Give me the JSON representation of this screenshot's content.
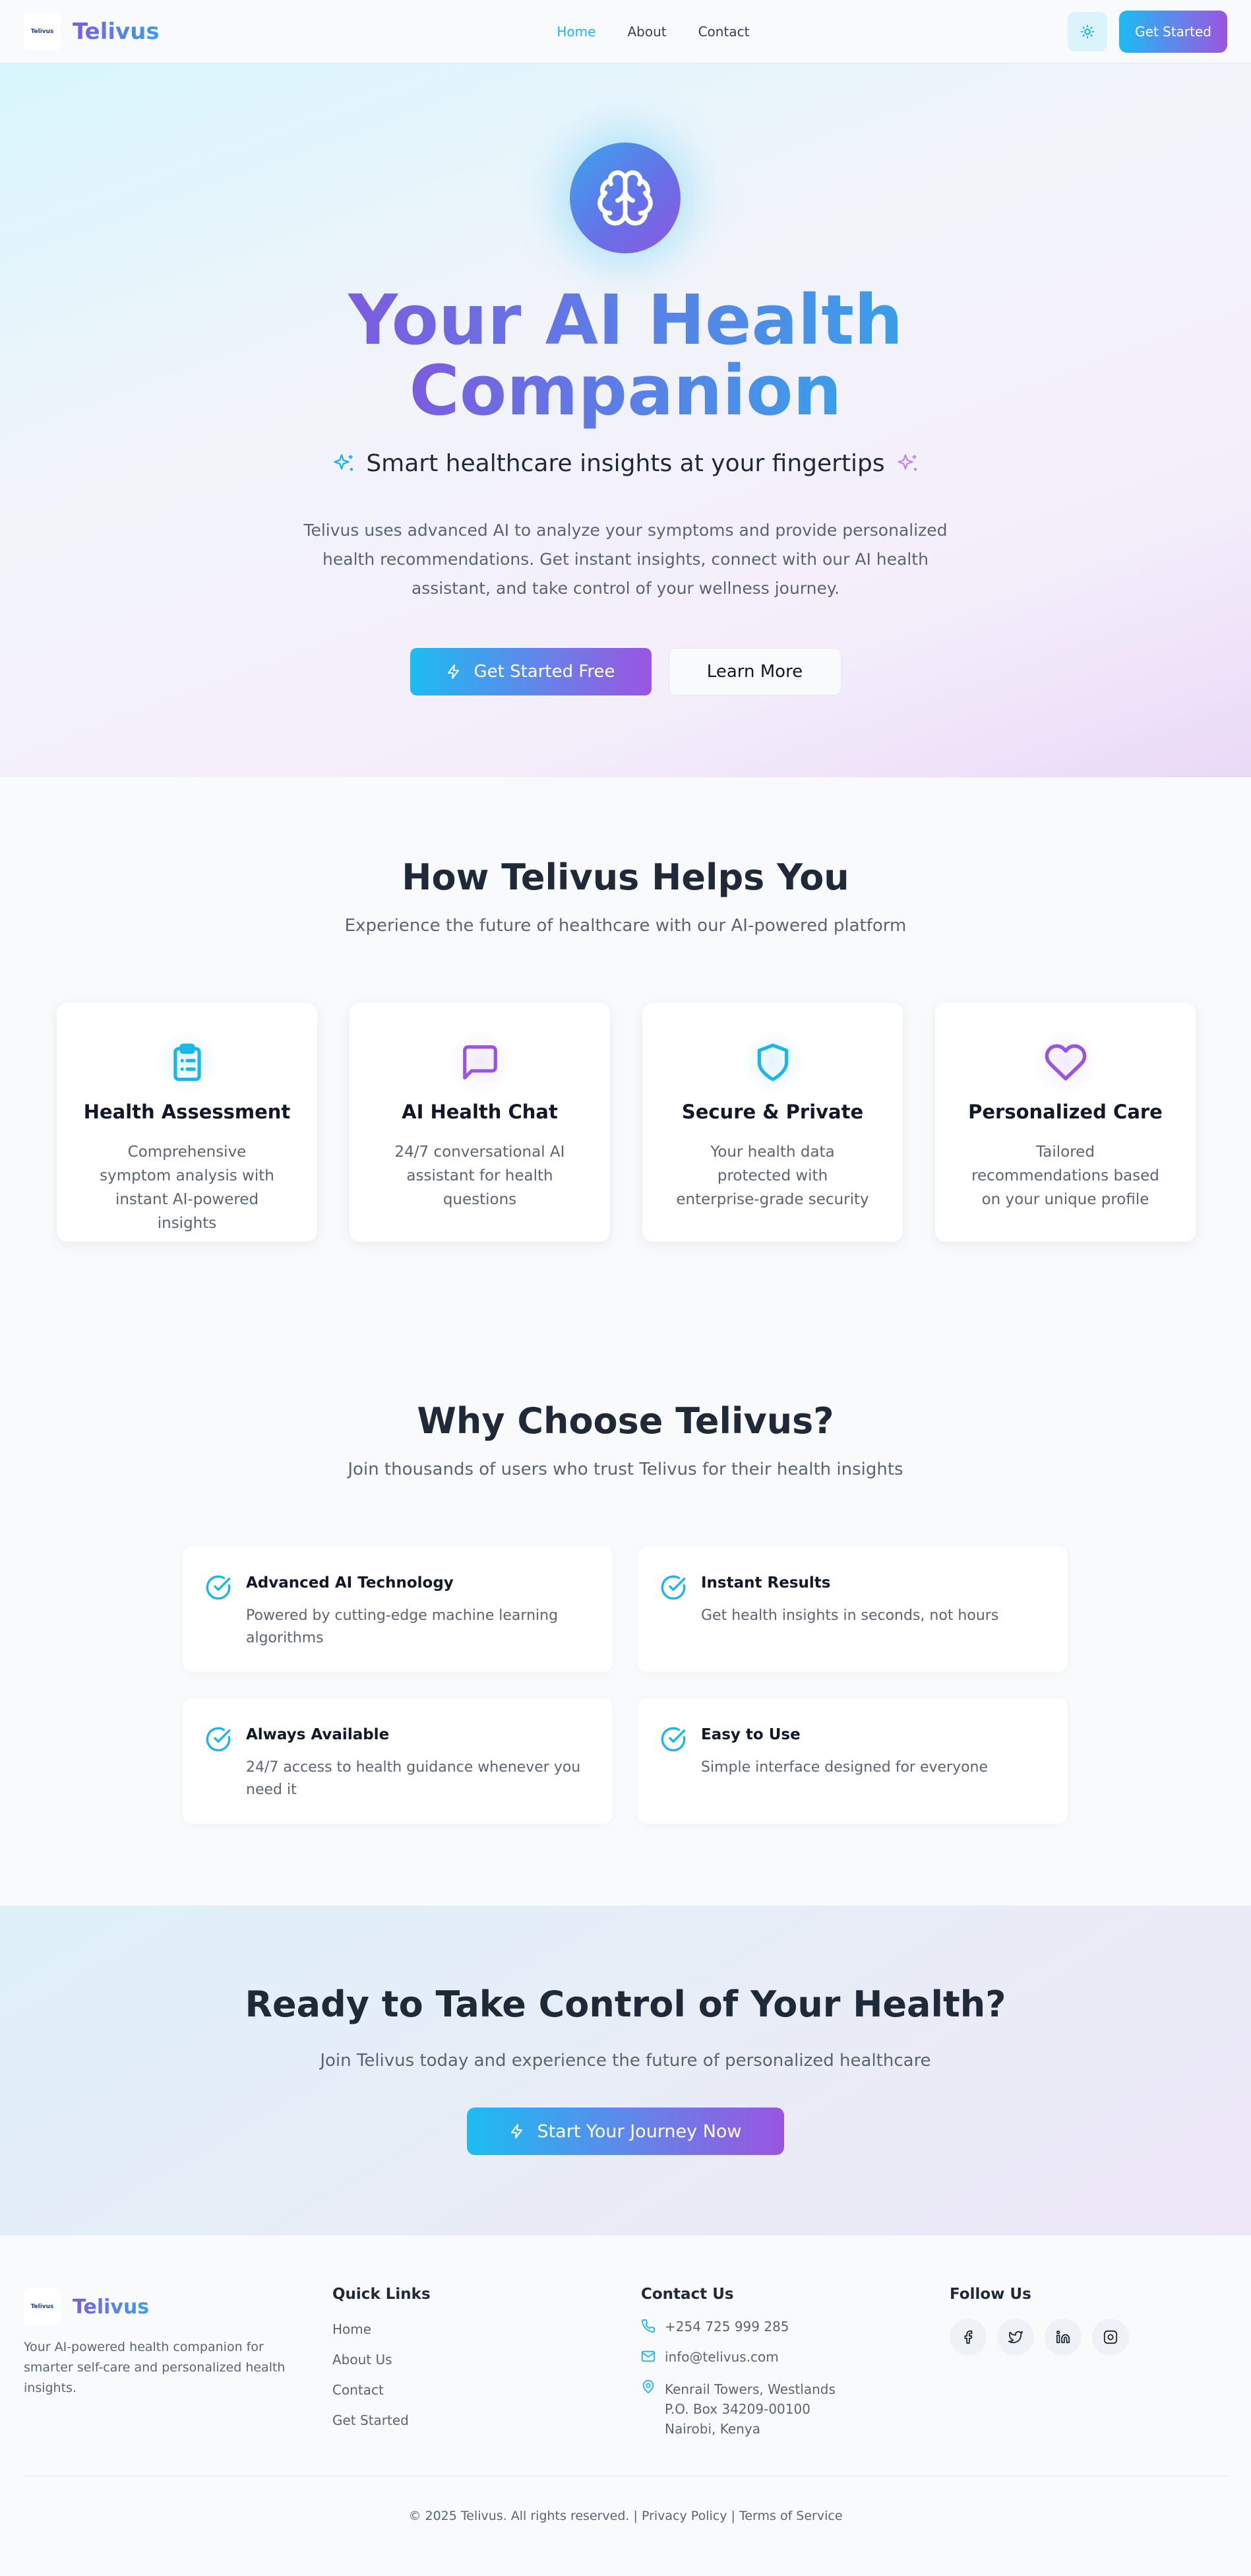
{
  "nav": {
    "logo_text": "Telivus",
    "brand": "Telivus",
    "links": [
      {
        "label": "Home",
        "active": true
      },
      {
        "label": "About",
        "active": false
      },
      {
        "label": "Contact",
        "active": false
      }
    ],
    "theme_icon": "sun-icon",
    "cta_label": "Get Started"
  },
  "hero": {
    "icon": "brain-icon",
    "title_line1": "Your AI Health",
    "title_line2": "Companion",
    "tagline": "Smart healthcare insights at your fingertips",
    "description": "Telivus uses advanced AI to analyze your symptoms and provide personalized health recommendations. Get instant insights, connect with our AI health assistant, and take control of your wellness journey.",
    "primary_button": "Get Started Free",
    "secondary_button": "Learn More"
  },
  "features": {
    "title": "How Telivus Helps You",
    "subtitle": "Experience the future of healthcare with our AI-powered platform",
    "cards": [
      {
        "icon": "clipboard-icon",
        "title": "Health Assessment",
        "description": "Comprehensive symptom analysis with instant AI-powered insights"
      },
      {
        "icon": "chat-icon",
        "title": "AI Health Chat",
        "description": "24/7 conversational AI assistant for health questions"
      },
      {
        "icon": "shield-icon",
        "title": "Secure & Private",
        "description": "Your health data protected with enterprise-grade security"
      },
      {
        "icon": "heart-icon",
        "title": "Personalized Care",
        "description": "Tailored recommendations based on your unique profile"
      }
    ]
  },
  "why": {
    "title": "Why Choose Telivus?",
    "subtitle": "Join thousands of users who trust Telivus for their health insights",
    "items": [
      {
        "title": "Advanced AI Technology",
        "description": "Powered by cutting-edge machine learning algorithms"
      },
      {
        "title": "Instant Results",
        "description": "Get health insights in seconds, not hours"
      },
      {
        "title": "Always Available",
        "description": "24/7 access to health guidance whenever you need it"
      },
      {
        "title": "Easy to Use",
        "description": "Simple interface designed for everyone"
      }
    ]
  },
  "cta": {
    "title": "Ready to Take Control of Your Health?",
    "subtitle": "Join Telivus today and experience the future of personalized healthcare",
    "button": "Start Your Journey Now"
  },
  "footer": {
    "logo_text": "Telivus",
    "brand": "Telivus",
    "about": "Your AI-powered health companion for smarter self-care and personalized health insights.",
    "quick_links_title": "Quick Links",
    "quick_links": [
      "Home",
      "About Us",
      "Contact",
      "Get Started"
    ],
    "contact_title": "Contact Us",
    "phone": "+254 725 999 285",
    "email": "info@telivus.com",
    "address_line1": "Kenrail Towers, Westlands",
    "address_line2": "P.O. Box 34209-00100",
    "address_line3": "Nairobi, Kenya",
    "follow_title": "Follow Us",
    "socials": [
      "facebook-icon",
      "twitter-icon",
      "linkedin-icon",
      "instagram-icon"
    ],
    "copyright": "© 2025 Telivus. All rights reserved.",
    "separator": "|",
    "privacy": "Privacy Policy",
    "terms": "Terms of Service"
  },
  "colors": {
    "accent_cyan": "#19b6ea",
    "accent_purple": "#9a55e0",
    "text_dark": "#111827",
    "text_muted": "#5b6472"
  }
}
